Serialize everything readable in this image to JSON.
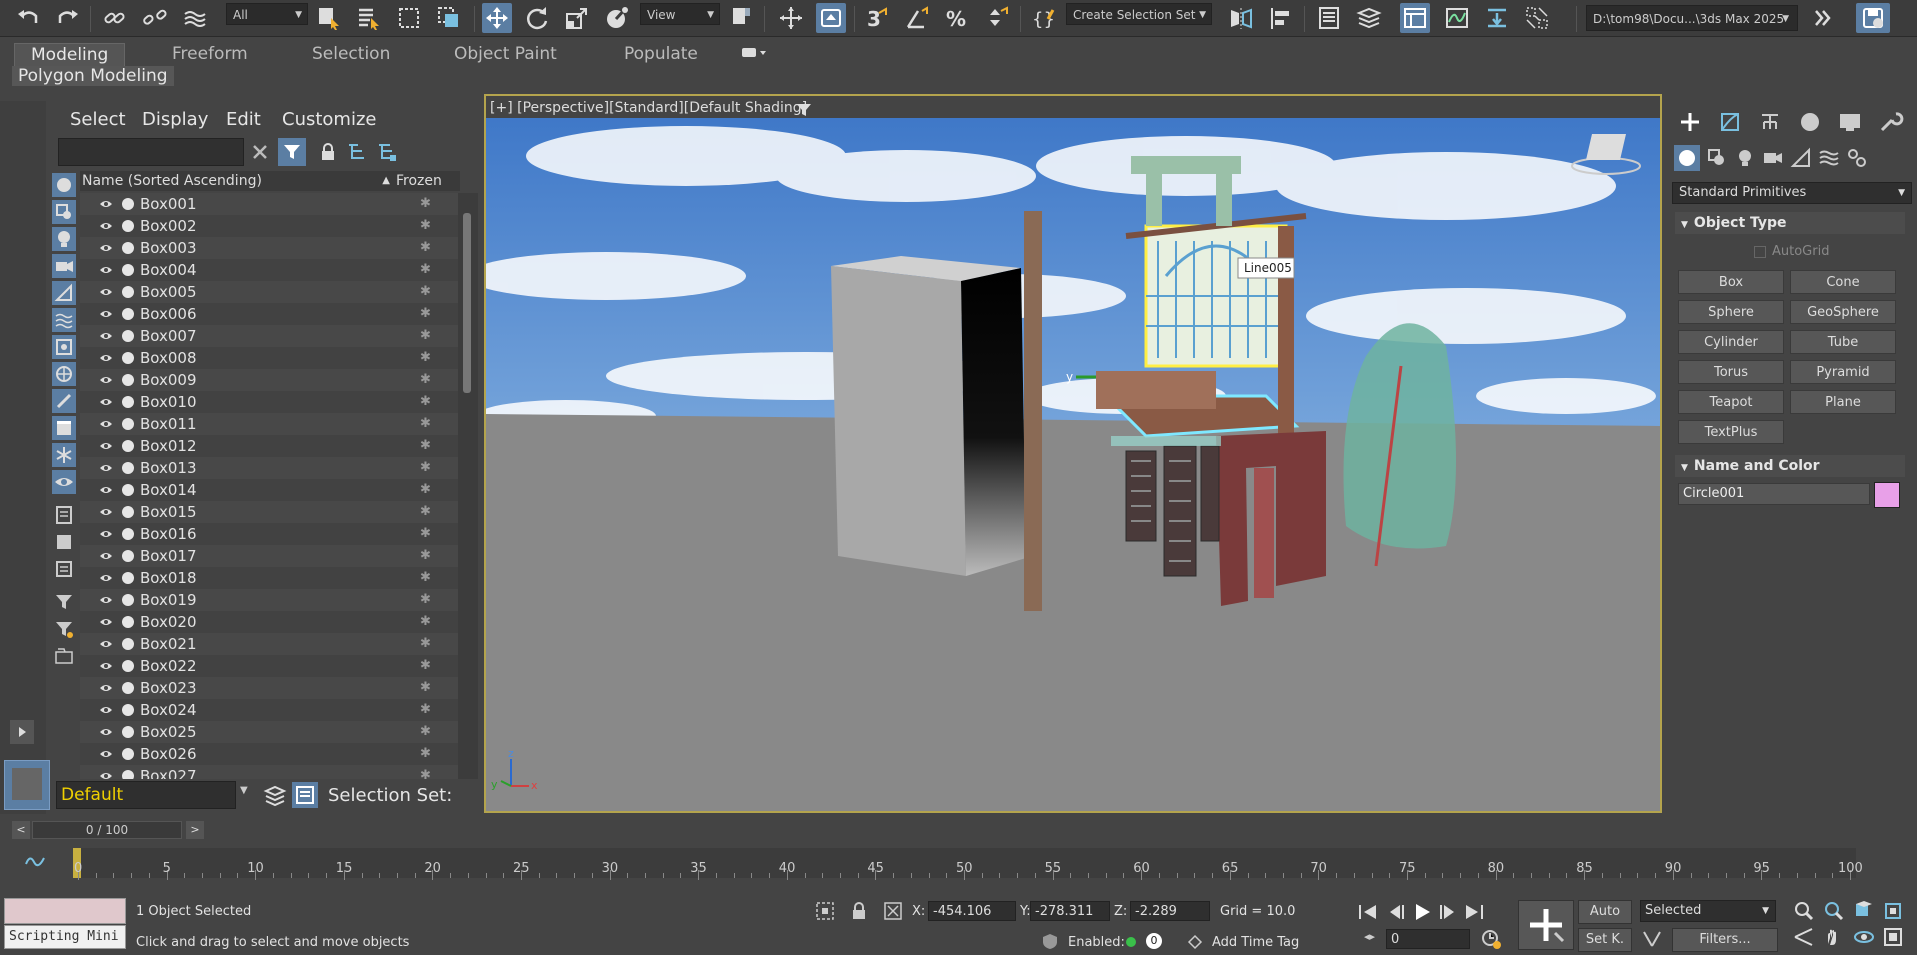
{
  "toolbar": {
    "filter_value": "All",
    "refcoord_value": "View",
    "selection_set": "Create Selection Set",
    "project_path": "D:\\tom98\\Docu...\\3ds Max 2025"
  },
  "ribbon": {
    "tabs": [
      "Modeling",
      "Freeform",
      "Selection",
      "Object Paint",
      "Populate"
    ],
    "active_tab": "Modeling",
    "panel_label": "Polygon Modeling"
  },
  "scene_explorer": {
    "menus": [
      "Select",
      "Display",
      "Edit",
      "Customize"
    ],
    "column_name": "Name (Sorted Ascending)",
    "column_frozen": "Frozen",
    "objects": [
      "Box001",
      "Box002",
      "Box003",
      "Box004",
      "Box005",
      "Box006",
      "Box007",
      "Box008",
      "Box009",
      "Box010",
      "Box011",
      "Box012",
      "Box013",
      "Box014",
      "Box015",
      "Box016",
      "Box017",
      "Box018",
      "Box019",
      "Box020",
      "Box021",
      "Box022",
      "Box023",
      "Box024",
      "Box025",
      "Box026",
      "Box027"
    ],
    "layer": "Default",
    "selection_set_label": "Selection Set:"
  },
  "viewport": {
    "label_plus": "[+]",
    "label_view": "[Perspective]",
    "label_standard": "[Standard]",
    "label_shading": "[Default Shading]",
    "tooltip": "Line005",
    "sky_color": "#4a86d0",
    "ground_color": "#8a8a8a",
    "selection_color": "#7fe8ff"
  },
  "command_panel": {
    "category": "Standard Primitives",
    "object_type_title": "Object Type",
    "autogrid_label": "AutoGrid",
    "buttons": [
      "Box",
      "Cone",
      "Sphere",
      "GeoSphere",
      "Cylinder",
      "Tube",
      "Torus",
      "Pyramid",
      "Teapot",
      "Plane",
      "TextPlus"
    ],
    "name_color_title": "Name and Color",
    "object_name": "Circle001",
    "object_color": "#e8a0e8"
  },
  "timeline": {
    "frame_display": "0 / 100",
    "ticks": [
      "0",
      "5",
      "10",
      "15",
      "20",
      "25",
      "30",
      "35",
      "40",
      "45",
      "50",
      "55",
      "60",
      "65",
      "70",
      "75",
      "80",
      "85",
      "90",
      "95",
      "100"
    ]
  },
  "status": {
    "script_label": "Scripting Mini",
    "selected_text": "1 Object Selected",
    "prompt_text": "Click and drag to select and move objects",
    "x_label": "X:",
    "x_value": "-454.106",
    "y_label": "Y:",
    "y_value": "-278.311",
    "z_label": "Z:",
    "z_value": "-2.289",
    "grid_text": "Grid = 10.0",
    "enabled_label": "Enabled:",
    "enabled_count": "0",
    "add_time_tag": "Add Time Tag",
    "auto_label": "Auto",
    "setk_label": "Set K.",
    "selected_dropdown": "Selected",
    "filters_label": "Filters...",
    "frame_value": "0"
  }
}
